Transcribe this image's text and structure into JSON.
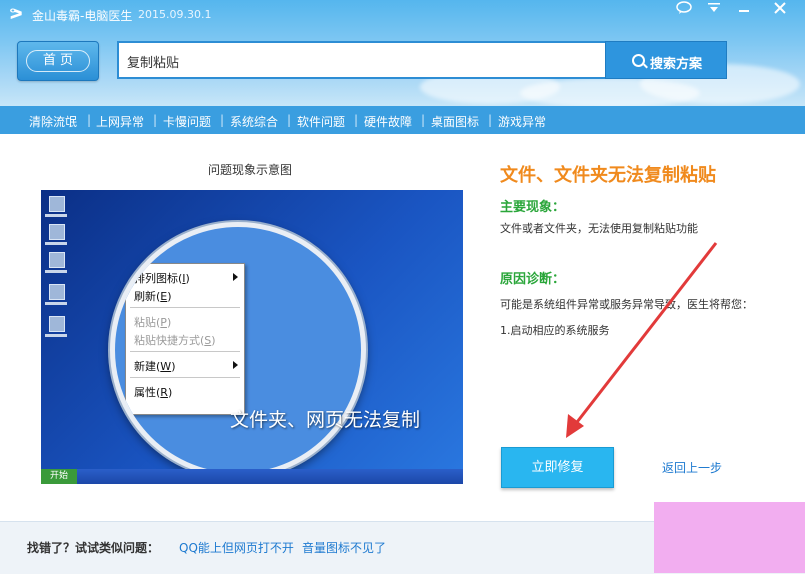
{
  "window": {
    "title": "金山毒霸-电脑医生",
    "version": "2015.09.30.1",
    "controls": [
      "chat-icon",
      "menu-icon",
      "minimize-icon",
      "close-icon"
    ]
  },
  "header": {
    "home_label": "首 页",
    "search_value": "复制粘贴",
    "search_button_label": "搜索方案"
  },
  "categories": [
    "清除流氓",
    "上网异常",
    "卡慢问题",
    "系统综合",
    "软件问题",
    "硬件故障",
    "桌面图标",
    "游戏异常"
  ],
  "demo": {
    "caption": "问题现象示意图",
    "menu_items": [
      {
        "label": "排列图标",
        "key": "I",
        "disabled": false,
        "submenu": true
      },
      {
        "label": "刷新",
        "key": "E",
        "disabled": false,
        "submenu": false
      },
      {
        "label": "粘贴",
        "key": "P",
        "disabled": true,
        "submenu": false
      },
      {
        "label": "粘贴快捷方式",
        "key": "S",
        "disabled": true,
        "submenu": false
      },
      {
        "label": "新建",
        "key": "W",
        "disabled": false,
        "submenu": true
      },
      {
        "label": "属性",
        "key": "R",
        "disabled": false,
        "submenu": false
      }
    ],
    "overlay_text": "文件夹、网页无法复制",
    "start_label": "开始"
  },
  "issue": {
    "title": "文件、文件夹无法复制粘贴",
    "symptom_heading": "主要现象：",
    "symptom_text": "文件或者文件夹，无法使用复制粘贴功能",
    "diagnosis_heading": "原因诊断：",
    "diagnosis_text": "可能是系统组件异常或服务异常导致，医生将帮您：",
    "diagnosis_step": "1.启动相应的系统服务",
    "fix_button": "立即修复",
    "back_link": "返回上一步"
  },
  "footer": {
    "label": "找错了？试试类似问题：",
    "links": [
      "QQ能上但网页打不开",
      "音量图标不见了"
    ]
  },
  "colors": {
    "accent_blue": "#2e95de",
    "title_orange": "#f08a1d",
    "heading_green": "#2aa63a",
    "fix_button": "#29b6f0",
    "arrow_red": "#e23a3a"
  }
}
